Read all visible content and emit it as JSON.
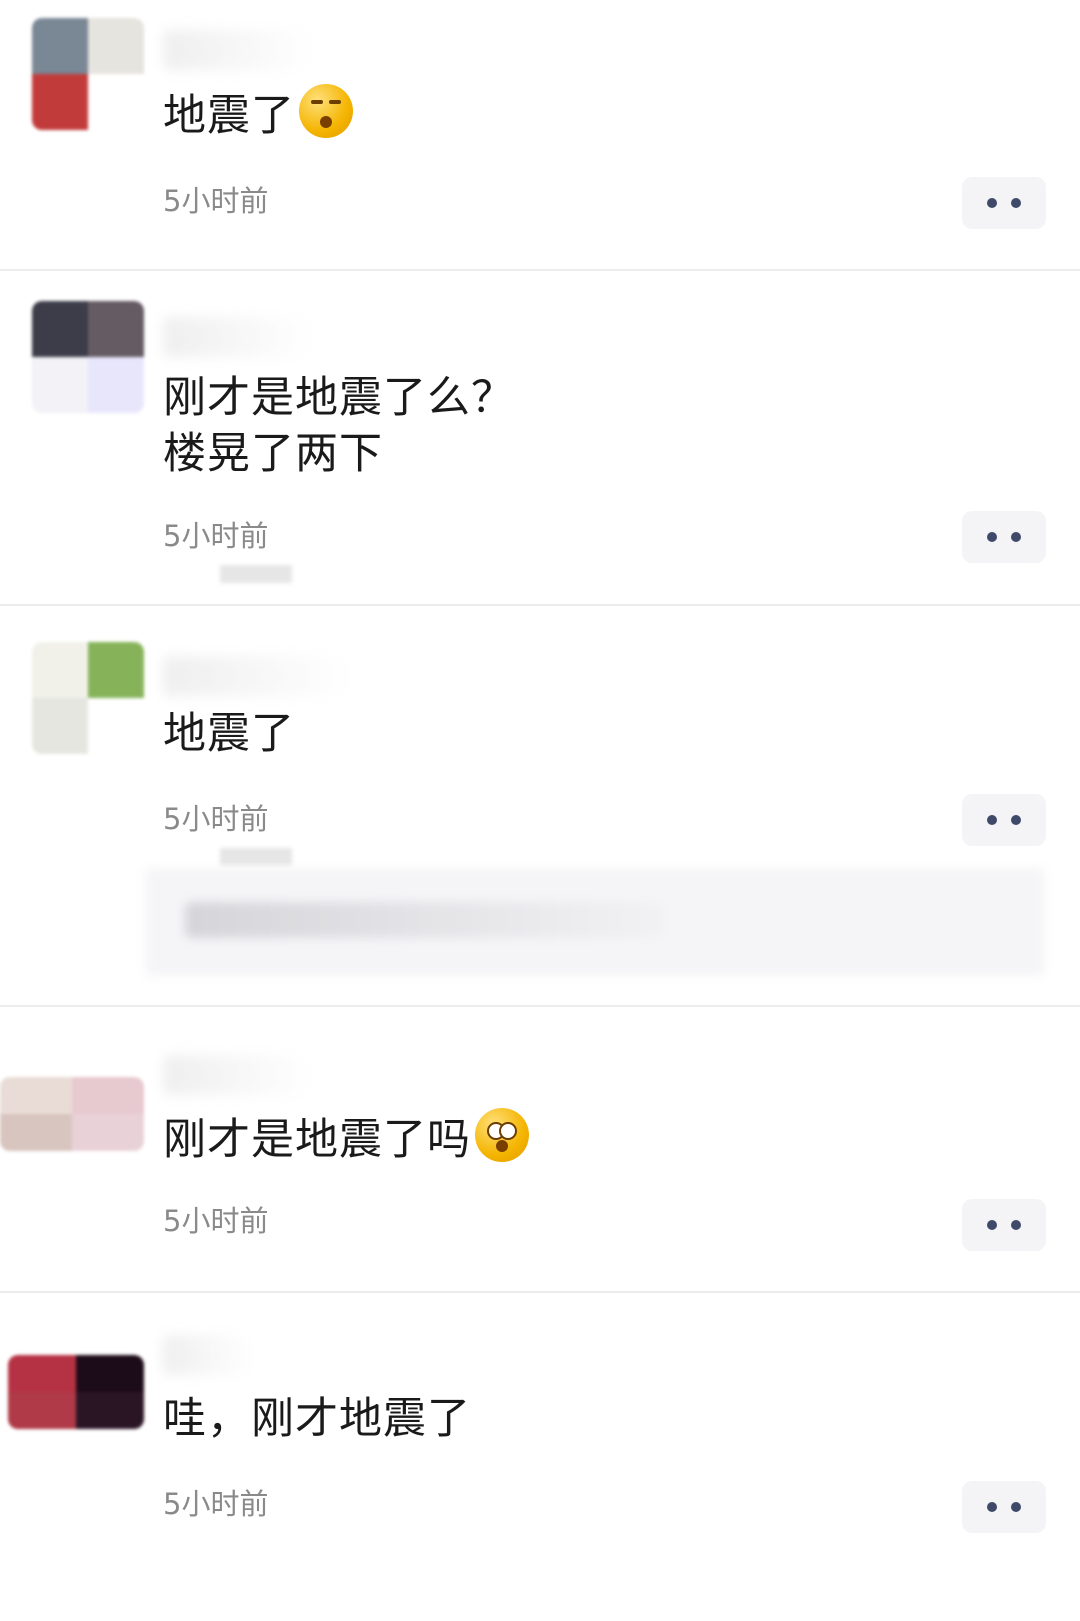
{
  "comments": [
    {
      "text": "地震了",
      "emoji": "sleepy-face-icon",
      "time": "5小时前",
      "avatar_colors": [
        "#7a8795",
        "#e6e4de",
        "#c23b3b",
        "#ffffff"
      ]
    },
    {
      "text": "刚才是地震了么？\n楼晃了两下",
      "emoji": null,
      "time": "5小时前",
      "avatar_colors": [
        "#3d3d49",
        "#655b63",
        "#f2f2f7",
        "#e8e6fb"
      ]
    },
    {
      "text": "地震了",
      "emoji": null,
      "time": "5小时前",
      "avatar_colors": [
        "#f1f1ea",
        "#86b35a",
        "#e6e6e0",
        "#ffffff"
      ]
    },
    {
      "text": "刚才是地震了吗",
      "emoji": "astonished-face-icon",
      "time": "5小时前",
      "avatar_colors": [
        "#e9dcd6",
        "#e7c9d0",
        "#d9c5bf",
        "#e8d2d8"
      ]
    },
    {
      "text": "哇，刚才地震了",
      "emoji": null,
      "time": "5小时前",
      "avatar_colors": [
        "#b53244",
        "#1c0b18",
        "#b03a48",
        "#2a1524"
      ]
    }
  ],
  "more_button": {
    "icon": "more-dots-icon",
    "color": "#3f4a6b"
  }
}
